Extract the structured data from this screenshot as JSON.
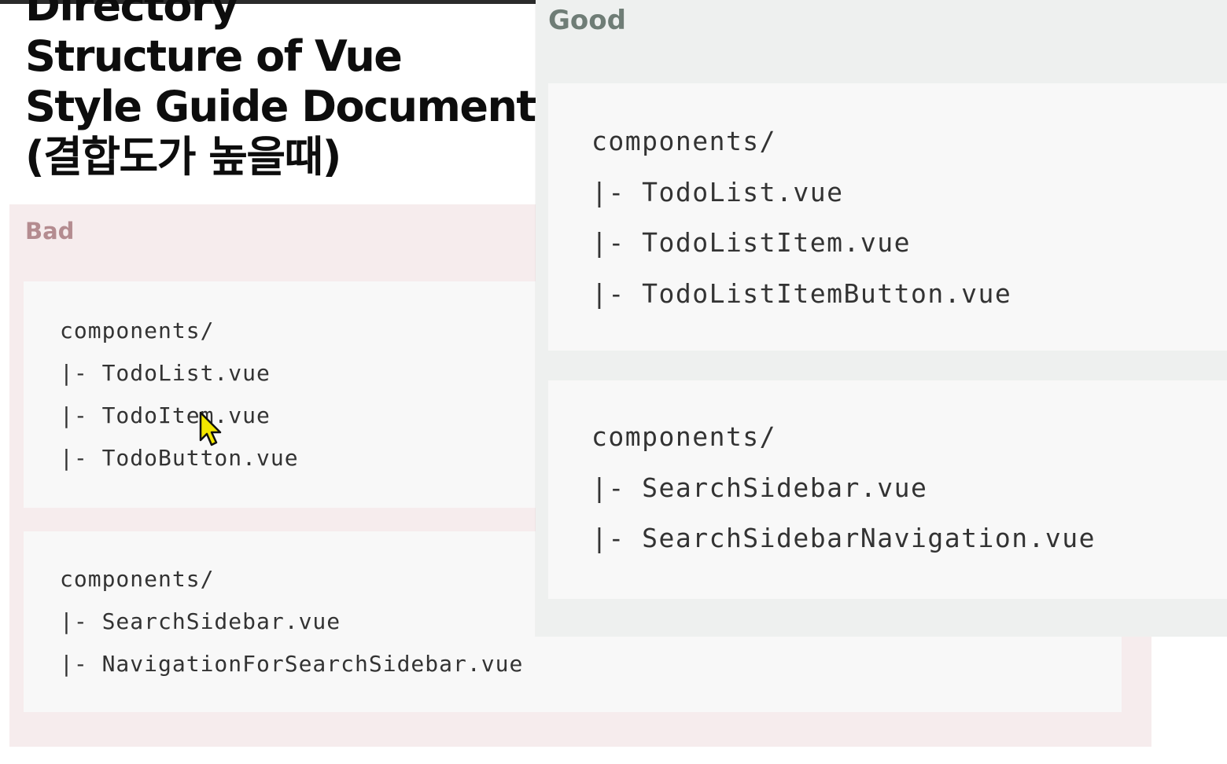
{
  "title": {
    "lines": [
      "Directory",
      "Structure of Vue",
      "Style Guide Document",
      "(결합도가 높을때)"
    ]
  },
  "bad": {
    "label": "Bad",
    "blocks": [
      {
        "lines": [
          "components/",
          "|- TodoList.vue",
          "|- TodoItem.vue",
          "|- TodoButton.vue"
        ]
      },
      {
        "lines": [
          "components/",
          "|- SearchSidebar.vue",
          "|- NavigationForSearchSidebar.vue"
        ]
      }
    ]
  },
  "good": {
    "label": "Good",
    "blocks": [
      {
        "lines": [
          "components/",
          "|- TodoList.vue",
          "|- TodoListItem.vue",
          "|- TodoListItemButton.vue"
        ]
      },
      {
        "lines": [
          "components/",
          "|- SearchSidebar.vue",
          "|- SearchSidebarNavigation.vue"
        ]
      }
    ]
  },
  "cursor_icon": "mouse-pointer-icon",
  "colors": {
    "bad_bg": "#f6eced",
    "bad_label": "#b48c90",
    "good_bg": "#eef0ef",
    "good_label": "#6f7d76",
    "code_bg": "#f8f8f8",
    "code_text": "#333333",
    "cursor_fill": "#f2e600"
  }
}
